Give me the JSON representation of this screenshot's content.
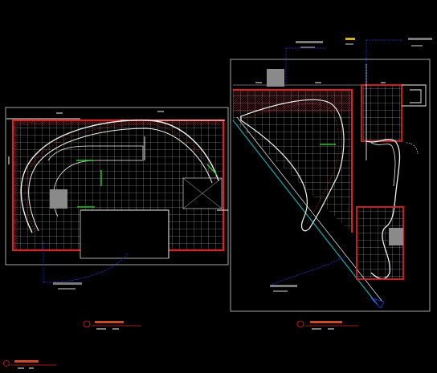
{
  "drawing": {
    "background": "#000000",
    "colors": {
      "grid": "#d8d8d8",
      "paving_edge": "#e02020",
      "sheet_frame": "#cfcfcf",
      "curve": "#f2f2f2",
      "leader": "#2a3aff",
      "planting_band": "#18a7b5",
      "stair_mark": "#22cc22",
      "fill_block": "#8a8a8a"
    },
    "plans": [
      {
        "id": "left-plan",
        "title_block": "",
        "scale_note": ""
      },
      {
        "id": "right-plan",
        "title_block": "",
        "scale_note": ""
      }
    ],
    "main_title": ""
  }
}
